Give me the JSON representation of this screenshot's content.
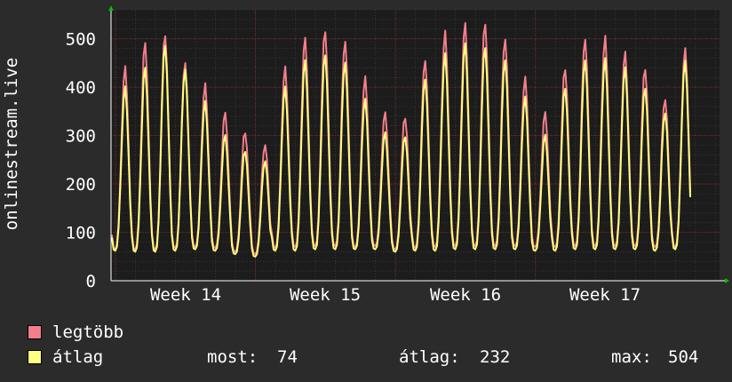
{
  "chart_data": {
    "type": "line",
    "ylabel": "onlinestream.live",
    "y_ticks": [
      0,
      100,
      200,
      300,
      400,
      500
    ],
    "x_ticks": [
      "Week 14",
      "Week 15",
      "Week 16",
      "Week 17"
    ],
    "ylim": [
      0,
      560
    ],
    "grid": true,
    "days": 29,
    "series": [
      {
        "name": "legtöbb",
        "color": "#f47f8b",
        "daily_peak": [
          440,
          490,
          512,
          455,
          405,
          345,
          310,
          285,
          440,
          500,
          520,
          500,
          420,
          345,
          340,
          460,
          515,
          530,
          535,
          505,
          420,
          345,
          440,
          505,
          505,
          470,
          440,
          380,
          480
        ],
        "daily_min": [
          65,
          65,
          65,
          68,
          70,
          68,
          60,
          55,
          68,
          70,
          72,
          72,
          70,
          72,
          65,
          68,
          70,
          72,
          72,
          72,
          72,
          70,
          70,
          72,
          72,
          72,
          72,
          70,
          70
        ]
      },
      {
        "name": "átlag",
        "color": "#ffff80",
        "daily_peak": [
          400,
          440,
          490,
          440,
          370,
          300,
          270,
          250,
          400,
          455,
          470,
          455,
          375,
          305,
          300,
          420,
          470,
          490,
          485,
          460,
          380,
          300,
          400,
          460,
          460,
          440,
          400,
          350,
          455
        ],
        "daily_min": [
          62,
          60,
          60,
          62,
          65,
          62,
          55,
          50,
          62,
          62,
          65,
          65,
          65,
          65,
          60,
          62,
          62,
          65,
          65,
          65,
          65,
          62,
          62,
          65,
          65,
          65,
          65,
          62,
          65
        ]
      }
    ],
    "stats": {
      "most_label": "most:",
      "most": "74",
      "atlag_label": "átlag:",
      "atlag": "232",
      "max_label": "max:",
      "max": "504"
    }
  }
}
